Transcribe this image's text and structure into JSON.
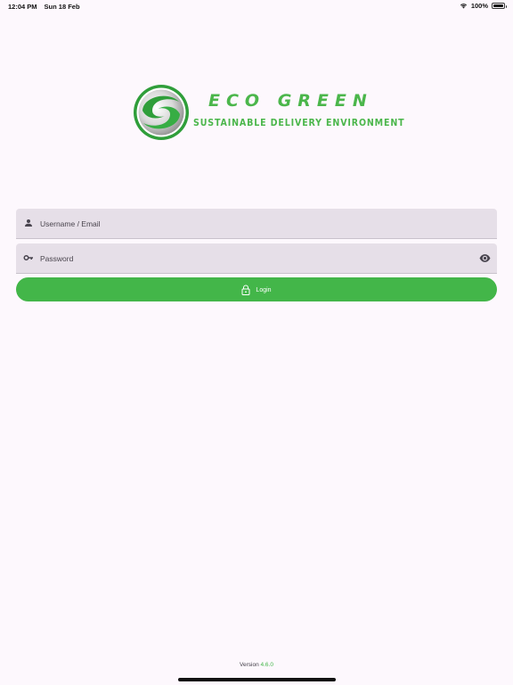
{
  "status_bar": {
    "time": "12:04 PM",
    "date": "Sun 18 Feb",
    "battery": "100%"
  },
  "logo": {
    "title": "ECO GREEN",
    "subtitle": "SUSTAINABLE DELIVERY ENVIRONMENT"
  },
  "login_form": {
    "username_placeholder": "Username / Email",
    "username_value": "",
    "password_placeholder": "Password",
    "password_value": "",
    "login_label": "Login"
  },
  "footer": {
    "version_label": "Version",
    "version_number": "4.6.0"
  },
  "colors": {
    "accent": "#43b649",
    "background": "#fdf8fd",
    "field_background": "#e6dfe8"
  },
  "icons": {
    "username": "person-icon",
    "password": "key-icon",
    "toggle_visibility": "eye-icon",
    "login": "lock-icon"
  }
}
